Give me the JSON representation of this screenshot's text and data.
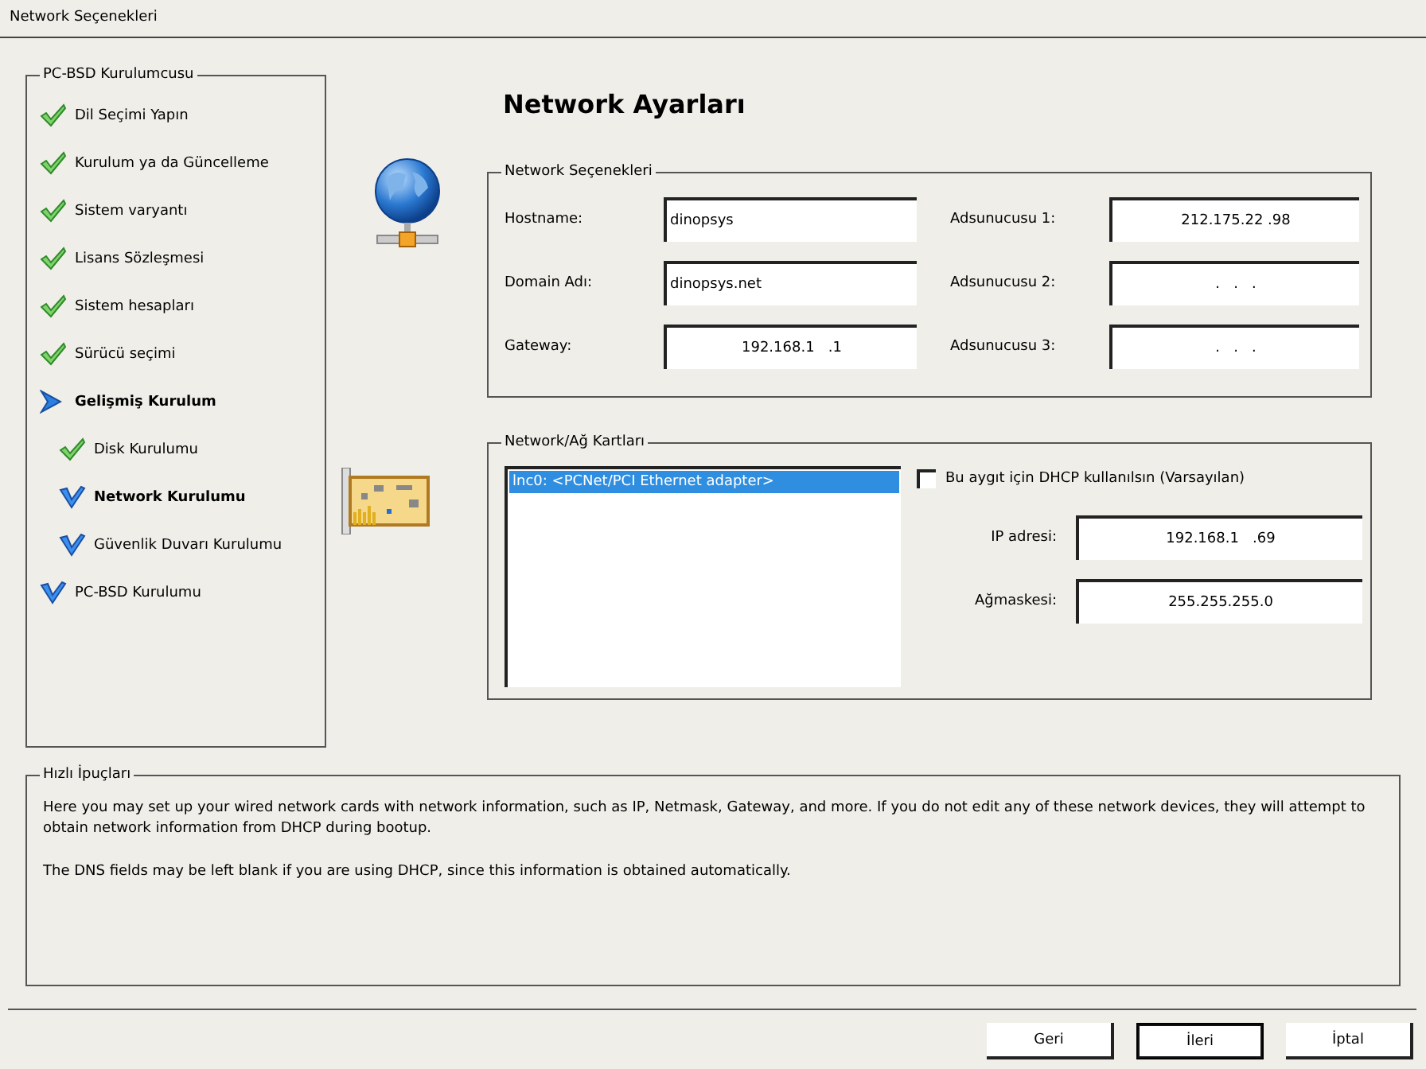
{
  "window": {
    "title": "Network Seçenekleri"
  },
  "sidebar": {
    "title": "PC-BSD Kurulumcusu",
    "steps": [
      {
        "label": "Dil Seçimi Yapın",
        "kind": "done"
      },
      {
        "label": "Kurulum ya da Güncelleme",
        "kind": "done"
      },
      {
        "label": "Sistem varyantı",
        "kind": "done"
      },
      {
        "label": "Lisans Sözleşmesi",
        "kind": "done"
      },
      {
        "label": "Sistem hesapları",
        "kind": "done"
      },
      {
        "label": "Sürücü seçimi",
        "kind": "done"
      },
      {
        "label": "Gelişmiş Kurulum",
        "kind": "current",
        "children": [
          {
            "label": "Disk Kurulumu",
            "kind": "done"
          },
          {
            "label": "Network Kurulumu",
            "kind": "active"
          },
          {
            "label": "Güvenlik Duvarı Kurulumu",
            "kind": "todo"
          }
        ]
      },
      {
        "label": "PC-BSD Kurulumu",
        "kind": "todo"
      }
    ]
  },
  "heading": "Network Ayarları",
  "network_options": {
    "title": "Network Seçenekleri",
    "fields": [
      {
        "label": "Hostname:",
        "value": "dinopsys",
        "kind": "text"
      },
      {
        "label": "Adsunucusu 1:",
        "value": "212.175.22 .98",
        "kind": "ip"
      },
      {
        "label": "Domain Adı:",
        "value": "dinopsys.net",
        "kind": "text"
      },
      {
        "label": "Adsunucusu 2:",
        "value": ".   .   .",
        "kind": "ip"
      },
      {
        "label": "Gateway:",
        "value": "192.168.1   .1",
        "kind": "ip"
      },
      {
        "label": "Adsunucusu 3:",
        "value": ".   .   .",
        "kind": "ip"
      }
    ]
  },
  "network_cards": {
    "title": "Network/Ağ Kartları",
    "cards": [
      {
        "label": "lnc0: <PCNet/PCI Ethernet adapter>",
        "selected": true
      }
    ],
    "dhcp": {
      "label": "Bu aygıt için DHCP kullanılsın (Varsayılan)",
      "checked": false
    },
    "fields": [
      {
        "label": "IP adresi:",
        "value": "192.168.1   .69"
      },
      {
        "label": "Ağmaskesi:",
        "value": "255.255.255.0"
      }
    ]
  },
  "hints": {
    "title": "Hızlı İpuçları",
    "paragraphs": [
      "Here you may set up your wired network cards with network information, such as IP, Netmask, Gateway, and more. If you do not edit any of these network devices, they will attempt to obtain network information from DHCP during bootup.",
      "The DNS fields may be left blank if you are using DHCP, since this information is obtained automatically."
    ]
  },
  "buttons": [
    {
      "label": "Geri",
      "focused": false
    },
    {
      "label": "İleri",
      "focused": true
    },
    {
      "label": "İptal",
      "focused": false
    }
  ]
}
